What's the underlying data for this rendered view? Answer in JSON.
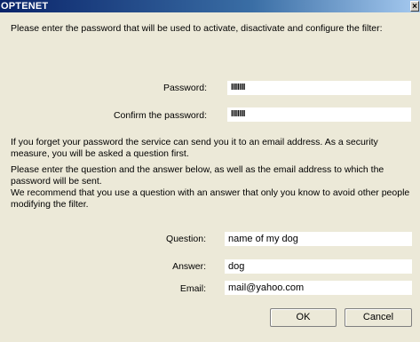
{
  "window": {
    "title": "OPTENET",
    "close_glyph": "×"
  },
  "intro_text": "Please enter the password that will be used to activate, disactivate and configure the filter:",
  "password": {
    "label": "Password:",
    "value": "IIIIIII"
  },
  "confirm_password": {
    "label": "Confirm the password:",
    "value": "IIIIIII"
  },
  "forgot_text": "If you forget your password the service can send you it to an email address. As a security measure, you will be asked a question first.",
  "instruction_text": "Please enter the question and the answer below, as well as the email address to which the password will be sent.",
  "recommend_text": "We recommend that you use a question with an answer that only you know to avoid other people modifying the filter.",
  "question": {
    "label": "Question:",
    "value": "name of my dog"
  },
  "answer": {
    "label": "Answer:",
    "value": "dog"
  },
  "email": {
    "label": "Email:",
    "value": "mail@yahoo.com"
  },
  "buttons": {
    "ok": "OK",
    "cancel": "Cancel"
  }
}
